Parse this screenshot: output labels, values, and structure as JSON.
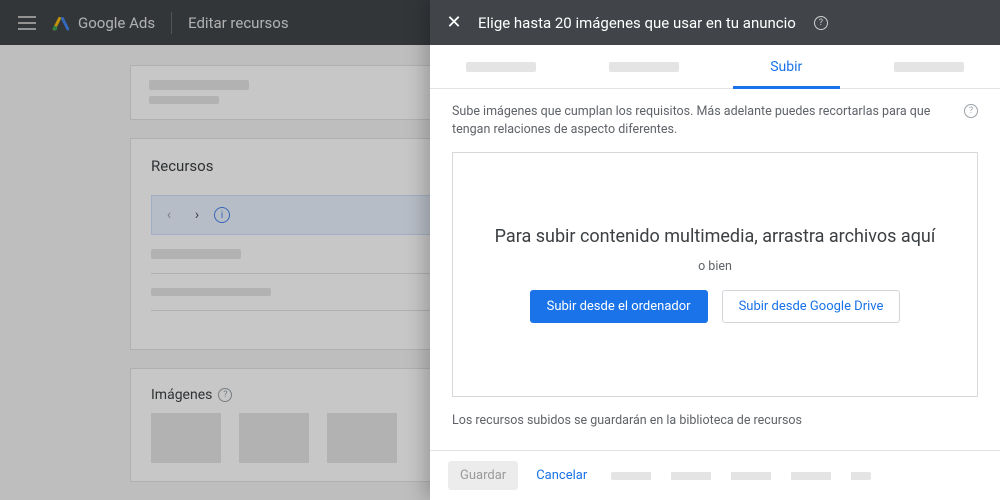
{
  "header": {
    "product": "Google Ads",
    "page": "Editar recursos"
  },
  "background": {
    "section_title": "Recursos",
    "images_title": "Imágenes"
  },
  "modal": {
    "title": "Elige hasta 20 imágenes que usar en tu anuncio",
    "tabs": {
      "active": "Subir"
    },
    "hint": "Sube imágenes que cumplan los requisitos. Más adelante puedes recortarlas para que tengan relaciones de aspecto diferentes.",
    "drop": {
      "main": "Para subir contenido multimedia, arrastra archivos aquí",
      "or": "o bien",
      "upload_computer": "Subir desde el ordenador",
      "upload_drive": "Subir desde Google Drive"
    },
    "library_note": "Los recursos subidos se guardarán en la biblioteca de recursos",
    "footer": {
      "save": "Guardar",
      "cancel": "Cancelar"
    }
  }
}
